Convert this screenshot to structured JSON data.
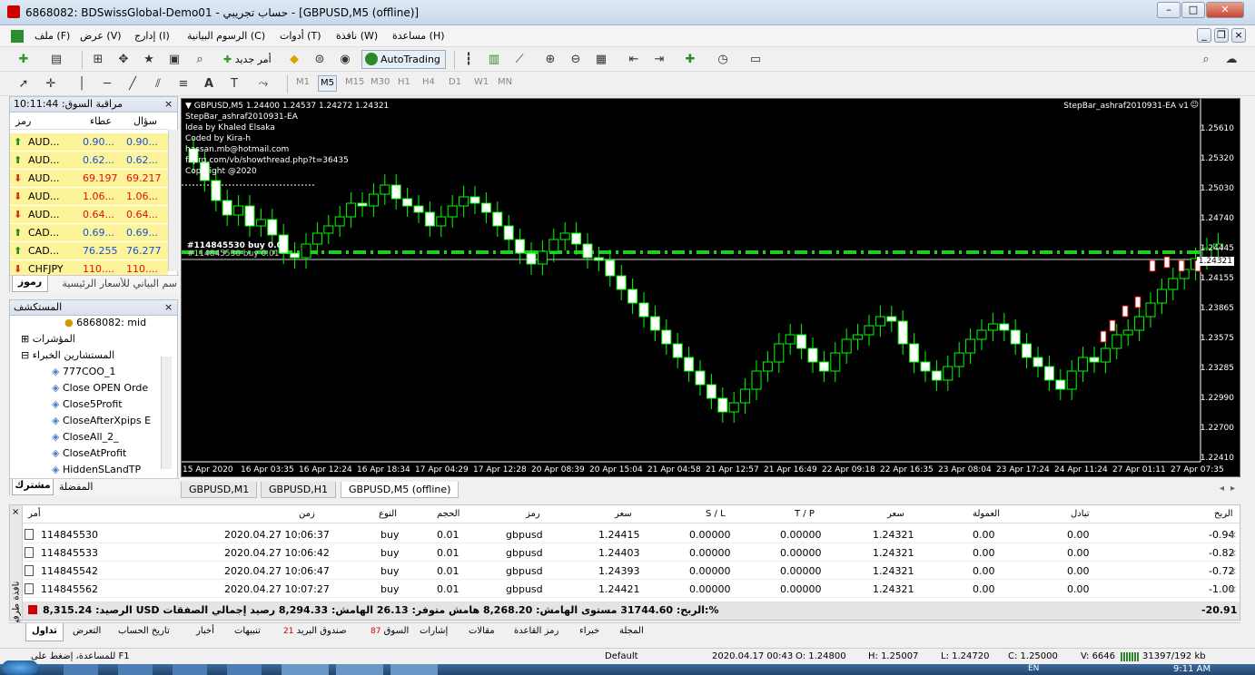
{
  "window": {
    "title": "6868082: BDSwissGlobal-Demo01 - حساب تجريبي - [GBPUSD,M5 (offline)]"
  },
  "menu": [
    "ملف (F)",
    "عرض (V)",
    "إدارج (I)",
    "الرسوم البيانية (C)",
    "أدوات (T)",
    "نافذة (W)",
    "مساعدة (H)"
  ],
  "toolbar": {
    "new_order": "أمر جديد",
    "autotrading": "AutoTrading"
  },
  "timeframes": [
    "M1",
    "M5",
    "M15",
    "M30",
    "H1",
    "H4",
    "D1",
    "W1",
    "MN"
  ],
  "market_watch": {
    "title": "مراقبة السوق: 10:11:44",
    "cols": {
      "symbol": "رمز",
      "bid": "عطاء",
      "ask": "سؤال"
    },
    "rows": [
      {
        "sym": "AUD...",
        "bid": "0.90...",
        "ask": "0.90...",
        "dir": "up"
      },
      {
        "sym": "AUD...",
        "bid": "0.62...",
        "ask": "0.62...",
        "dir": "up"
      },
      {
        "sym": "AUD...",
        "bid": "69.197",
        "ask": "69.217",
        "dir": "down"
      },
      {
        "sym": "AUD...",
        "bid": "1.06...",
        "ask": "1.06...",
        "dir": "down"
      },
      {
        "sym": "AUD...",
        "bid": "0.64...",
        "ask": "0.64...",
        "dir": "down"
      },
      {
        "sym": "CAD...",
        "bid": "0.69...",
        "ask": "0.69...",
        "dir": "up"
      },
      {
        "sym": "CAD...",
        "bid": "76.255",
        "ask": "76.277",
        "dir": "up"
      },
      {
        "sym": "CHFJPY",
        "bid": "110....",
        "ask": "110....",
        "dir": "down"
      }
    ],
    "tabs": [
      "رموز",
      "سم البياني للأسعار الرئيسية"
    ]
  },
  "navigator": {
    "title": "المستكشف",
    "account": "6868082: mid",
    "indicators": "المؤشرات",
    "experts": "المستشارين الخبراء",
    "items": [
      "777COO_1",
      "Close OPEN Orde",
      "Close5Profit",
      "CloseAfterXpips E",
      "CloseAll_2_",
      "CloseAtProfit",
      "HiddenSLandTP"
    ],
    "tabs": [
      "مشترك",
      "المفضلة"
    ]
  },
  "chart": {
    "header": "GBPUSD,M5  1.24400 1.24537 1.24272 1.24321",
    "ea_name": "StepBar_ashraf2010931-EA v1",
    "info_lines": [
      "StepBar_ashraf2010931-EA",
      "Idea by Khaled Elsaka",
      "Coded by Kira-h",
      "hassan.mb@hotmail.com",
      "fxprg.com/vb/showthread.php?t=36435",
      "Copyright @2020"
    ],
    "line_label1": "#114845530 buy 0.01",
    "line_label2": "#114845530 buy 0.01",
    "prices": [
      "1.25610",
      "1.25320",
      "1.25030",
      "1.24740",
      "1.24445",
      "1.24321",
      "1.24155",
      "1.23865",
      "1.23575",
      "1.23285",
      "1.22990",
      "1.22700",
      "1.22410"
    ],
    "dates": [
      "15 Apr 2020",
      "16 Apr 03:35",
      "16 Apr 12:24",
      "16 Apr 18:34",
      "17 Apr 04:29",
      "17 Apr 12:28",
      "20 Apr 08:39",
      "20 Apr 15:04",
      "21 Apr 04:58",
      "21 Apr 12:57",
      "21 Apr 16:49",
      "22 Apr 09:18",
      "22 Apr 16:35",
      "23 Apr 08:04",
      "23 Apr 17:24",
      "24 Apr 11:24",
      "27 Apr 01:11",
      "27 Apr 07:35"
    ],
    "tabs": [
      "GBPUSD,M1",
      "GBPUSD,H1",
      "GBPUSD,M5 (offline)"
    ]
  },
  "terminal": {
    "headers": {
      "order": "أمر",
      "time": "زمن",
      "type": "النوع",
      "size": "الحجم",
      "symbol": "رمز",
      "price": "سعر",
      "sl": "S / L",
      "tp": "T / P",
      "price2": "سعر",
      "commission": "العمولة",
      "swap": "تبادل",
      "profit": "الربح"
    },
    "rows": [
      {
        "order": "114845530",
        "time": "2020.04.27 10:06:37",
        "type": "buy",
        "size": "0.01",
        "symbol": "gbpusd",
        "price": "1.24415",
        "sl": "0.00000",
        "tp": "0.00000",
        "price2": "1.24321",
        "commission": "0.00",
        "swap": "0.00",
        "profit": "-0.94"
      },
      {
        "order": "114845533",
        "time": "2020.04.27 10:06:42",
        "type": "buy",
        "size": "0.01",
        "symbol": "gbpusd",
        "price": "1.24403",
        "sl": "0.00000",
        "tp": "0.00000",
        "price2": "1.24321",
        "commission": "0.00",
        "swap": "0.00",
        "profit": "-0.82"
      },
      {
        "order": "114845542",
        "time": "2020.04.27 10:06:47",
        "type": "buy",
        "size": "0.01",
        "symbol": "gbpusd",
        "price": "1.24393",
        "sl": "0.00000",
        "tp": "0.00000",
        "price2": "1.24321",
        "commission": "0.00",
        "swap": "0.00",
        "profit": "-0.72"
      },
      {
        "order": "114845562",
        "time": "2020.04.27 10:07:27",
        "type": "buy",
        "size": "0.01",
        "symbol": "gbpusd",
        "price": "1.24421",
        "sl": "0.00000",
        "tp": "0.00000",
        "price2": "1.24321",
        "commission": "0.00",
        "swap": "0.00",
        "profit": "-1.00"
      }
    ],
    "balance_line": "الرصيد: 8,315.24 USD  الربح: 31744.60  مستوى الهامش: 8,268.20  هامش متوفر: 26.13  الهامش: 8,294.33  رصيد إجمالي الصفقات:%",
    "total_profit": "-20.91",
    "side_label": "نافذة طرفية"
  },
  "bottom_tabs": [
    "تداول",
    "التعرض",
    "تاريخ الحساب",
    "أخبار",
    "تنبيهات",
    "صندوق البريد",
    "السوق",
    "إشارات",
    "مقالات",
    "رمز القاعدة",
    "خبراء",
    "المجلة"
  ],
  "bottom_tab_badges": {
    "mailbox": "21",
    "market": "87"
  },
  "status": {
    "help": "للمساعدة، إضغط على F1",
    "profile": "Default",
    "datetime": "2020.04.17 00:43",
    "o": "O: 1.24800",
    "h": "H: 1.25007",
    "l": "L: 1.24720",
    "c": "C: 1.25000",
    "v": "V: 6646",
    "traffic": "31397/192 kb"
  },
  "taskbar": {
    "lang": "EN",
    "clock": "9:11 AM"
  },
  "colors": {
    "bull": "#00ff00",
    "bear": "#ffffff",
    "background": "#000000",
    "grid_line": "#00c000"
  }
}
